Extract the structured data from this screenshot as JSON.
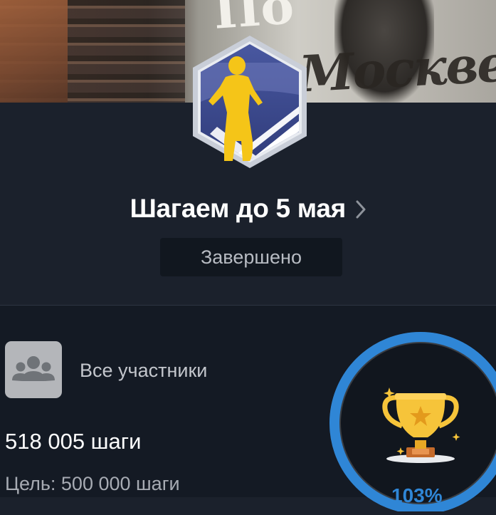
{
  "challenge": {
    "title": "Шагаем до 5 мая",
    "status": "Завершено"
  },
  "hero": {
    "poster_text": "Москве",
    "poster_top": "По"
  },
  "participants": {
    "label": "Все участники"
  },
  "progress": {
    "steps_text": "518 005 шаги",
    "goal_text": "Цель: 500 000 шаги",
    "percent_text": "103%",
    "ratio": 1.03
  },
  "colors": {
    "background": "#1b212c",
    "lower_background": "#141a24",
    "status_bg": "#11171f",
    "ring_blue": "#2f86d6",
    "badge_yellow": "#f5c518",
    "badge_navy": "#3a4a8f"
  },
  "icons": {
    "badge": "runner-hexagon-badge-icon",
    "chevron": "chevron-right-icon",
    "group": "group-users-icon",
    "trophy": "trophy-icon"
  }
}
